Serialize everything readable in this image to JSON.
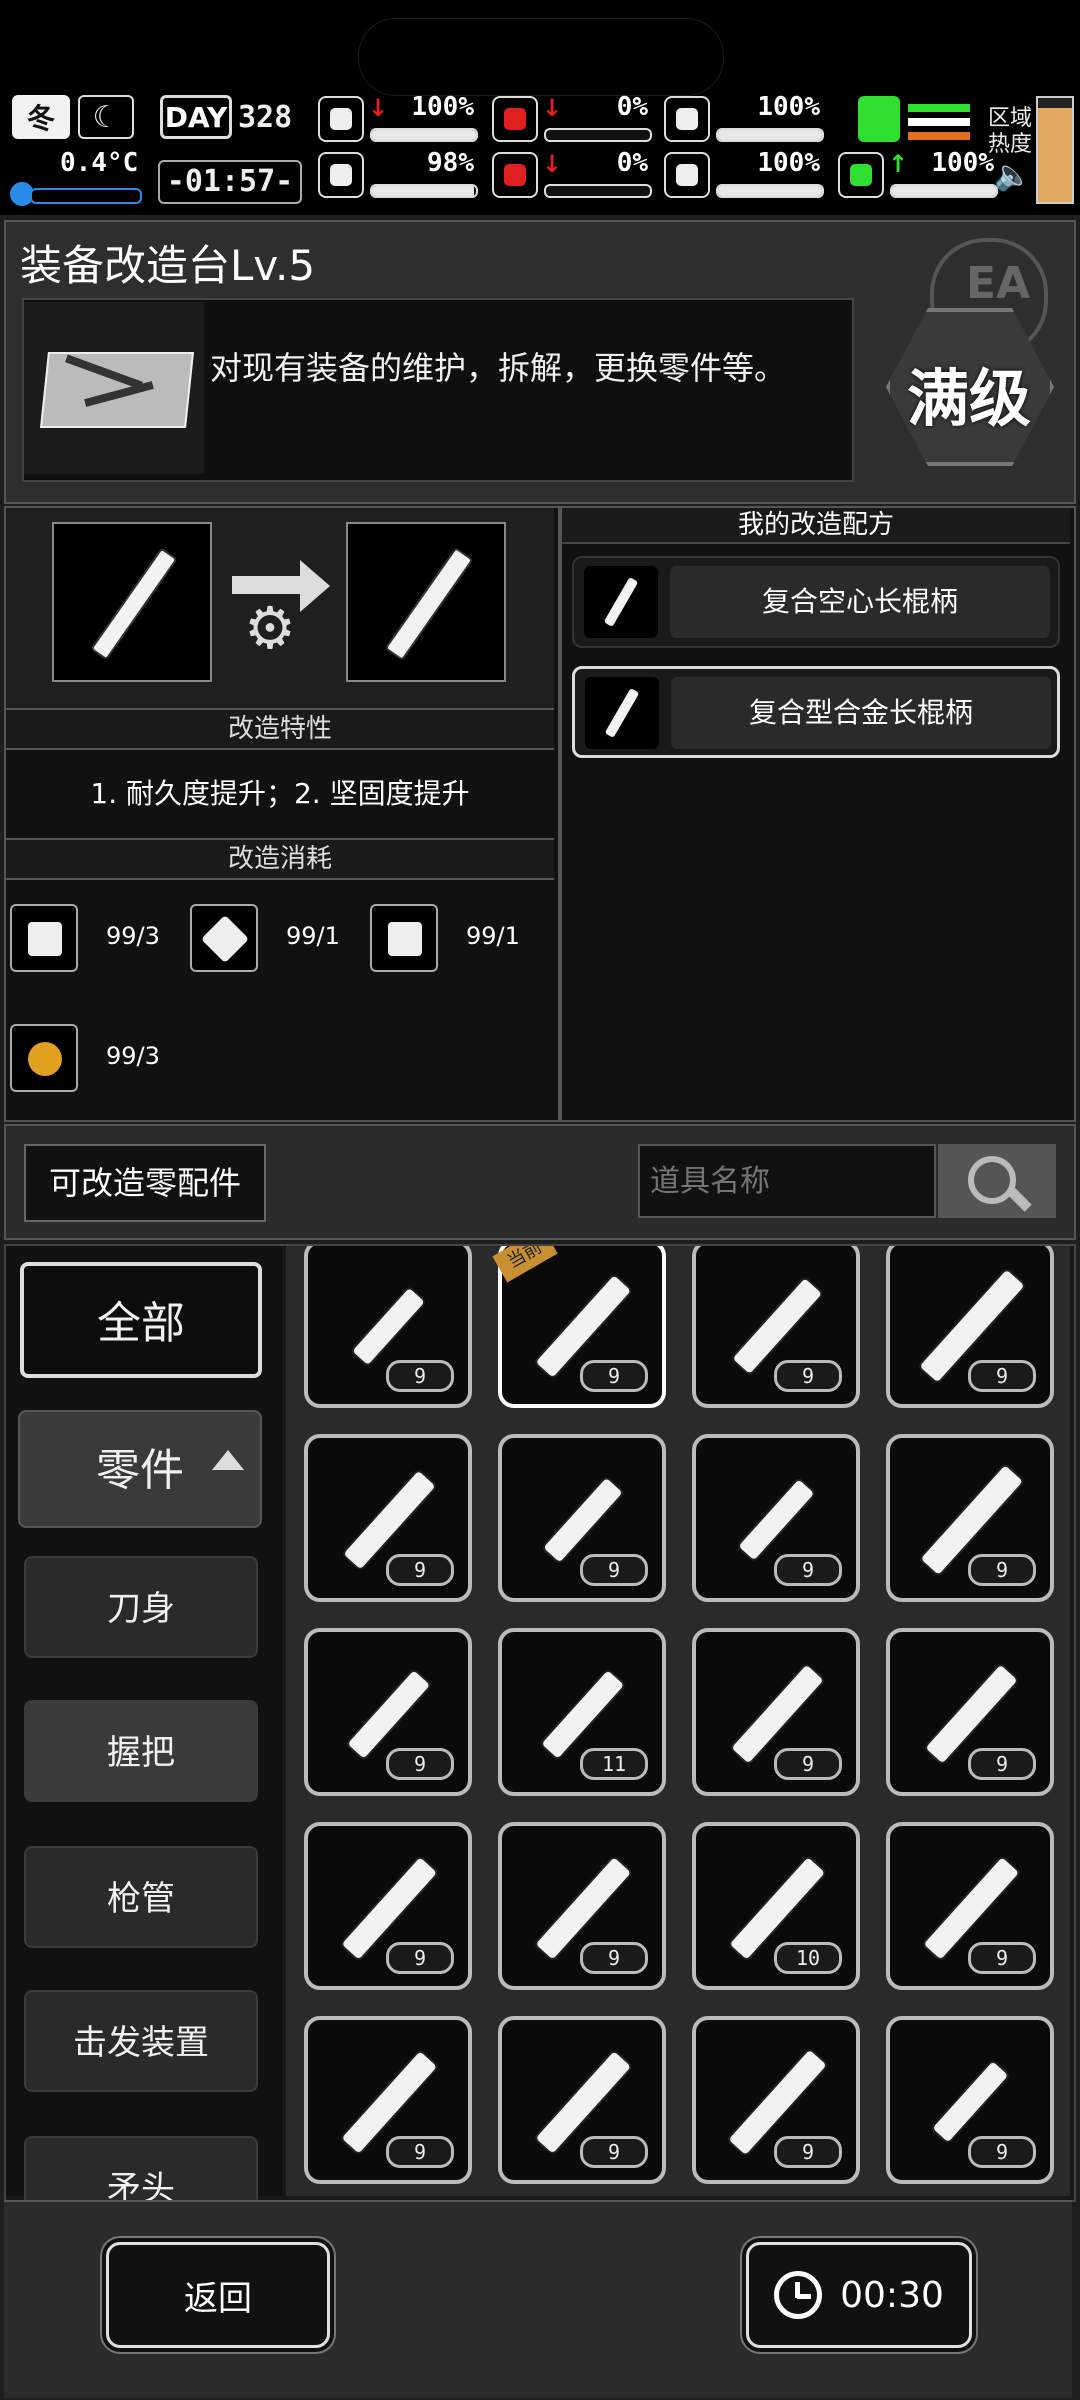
{
  "status": {
    "season": "冬",
    "temperature": "0.4°C",
    "day_label": "DAY",
    "day_number": "328",
    "clock": "-01:57-",
    "stats": [
      {
        "name": "health",
        "value": "100%",
        "fill": 1.0,
        "trend": "down"
      },
      {
        "name": "hunger",
        "value": "0%",
        "fill": 0.0,
        "trend": "down"
      },
      {
        "name": "energy",
        "value": "100%",
        "fill": 1.0,
        "trend": "none"
      },
      {
        "name": "sanity",
        "value": "98%",
        "fill": 0.98,
        "trend": "none"
      },
      {
        "name": "thirst",
        "value": "0%",
        "fill": 0.0,
        "trend": "down"
      },
      {
        "name": "heart",
        "value": "100%",
        "fill": 1.0,
        "trend": "none"
      },
      {
        "name": "stamina",
        "value": "100%",
        "fill": 1.0,
        "trend": "up"
      }
    ],
    "zone_label_1": "区域",
    "zone_label_2": "热度",
    "heat_level": 0.9,
    "accent_green": "#30e030",
    "accent_red": "#e02020"
  },
  "station": {
    "title": "装备改造台Lv.5",
    "description": "对现有装备的维护，拆解，更换零件等。",
    "max_badge": "满级",
    "stamp_text": "EA"
  },
  "modify": {
    "traits_header": "改造特性",
    "traits_text": "1. 耐久度提升；2. 坚固度提升",
    "cost_header": "改造消耗",
    "costs": [
      {
        "icon": "cloth-icon",
        "amount": "99/3"
      },
      {
        "icon": "tool-icon",
        "amount": "99/1"
      },
      {
        "icon": "fuel-can-icon",
        "amount": "99/1"
      },
      {
        "icon": "potion-icon",
        "amount": "99/3"
      }
    ]
  },
  "recipes": {
    "header": "我的改造配方",
    "items": [
      {
        "label": "复合空心长棍柄",
        "selected": false
      },
      {
        "label": "复合型合金长棍柄",
        "selected": true
      }
    ]
  },
  "filter": {
    "button": "可改造零配件",
    "search_placeholder": "道具名称"
  },
  "categories": [
    {
      "label": "全部",
      "state": "big"
    },
    {
      "label": "零件",
      "state": "active"
    },
    {
      "label": "刀身",
      "state": "normal"
    },
    {
      "label": "握把",
      "state": "highlight"
    },
    {
      "label": "枪管",
      "state": "normal"
    },
    {
      "label": "击发装置",
      "state": "normal"
    },
    {
      "label": "矛头",
      "state": "normal"
    }
  ],
  "current_badge": "当前",
  "grid": [
    {
      "count": "9",
      "len": 0.5
    },
    {
      "count": "9",
      "len": 0.85,
      "current": true
    },
    {
      "count": "9",
      "len": 0.75
    },
    {
      "count": "9",
      "len": 1.0
    },
    {
      "count": "9",
      "len": 0.8
    },
    {
      "count": "9",
      "len": 0.6
    },
    {
      "count": "9",
      "len": 0.55
    },
    {
      "count": "9",
      "len": 0.95
    },
    {
      "count": "9",
      "len": 0.65
    },
    {
      "count": "11",
      "len": 0.65
    },
    {
      "count": "9",
      "len": 0.8
    },
    {
      "count": "9",
      "len": 0.8
    },
    {
      "count": "9",
      "len": 0.85
    },
    {
      "count": "9",
      "len": 0.85
    },
    {
      "count": "10",
      "len": 0.85
    },
    {
      "count": "9",
      "len": 0.85
    },
    {
      "count": "9",
      "len": 0.85
    },
    {
      "count": "9",
      "len": 0.85
    },
    {
      "count": "9",
      "len": 0.9
    },
    {
      "count": "9",
      "len": 0.55
    }
  ],
  "footer": {
    "back": "返回",
    "timer": "00:30"
  }
}
